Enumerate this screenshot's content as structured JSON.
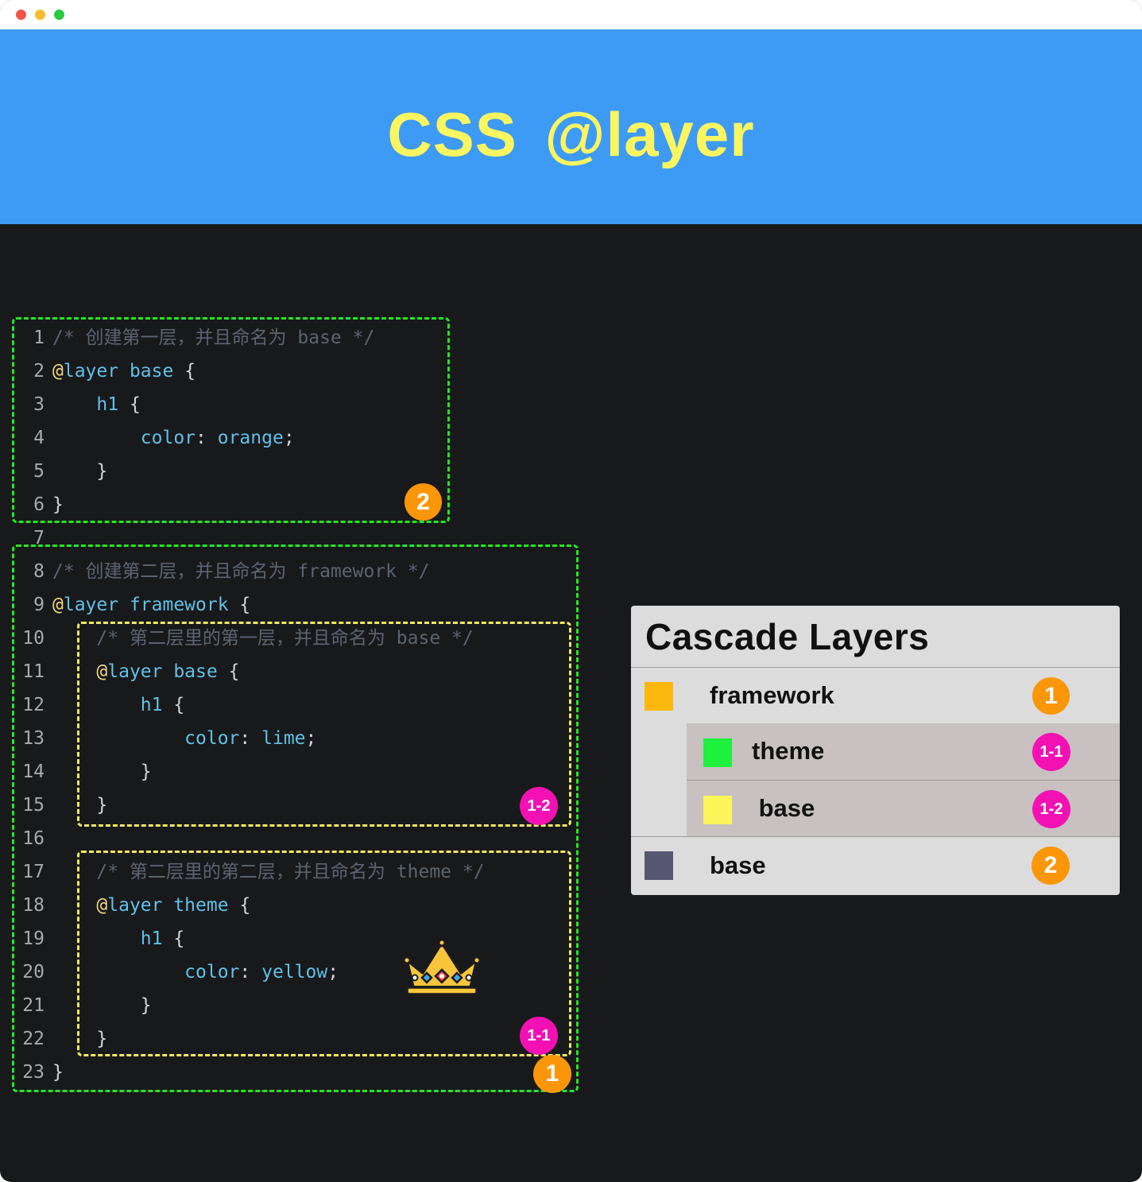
{
  "window": {
    "traffic_lights": [
      "close",
      "minimize",
      "maximize"
    ]
  },
  "banner": {
    "title": "CSS @layer"
  },
  "code": {
    "lines": [
      {
        "n": "1",
        "comment": "/* 创建第一层，并且命名为 base */"
      },
      {
        "n": "2",
        "at": "@",
        "kw": "layer base",
        "plain": " {"
      },
      {
        "n": "3",
        "indent": "    ",
        "kw": "h1",
        "plain": " {"
      },
      {
        "n": "4",
        "indent": "        ",
        "kw": "color",
        "plain": ": ",
        "kw2": "orange",
        "plain2": ";"
      },
      {
        "n": "5",
        "indent": "    ",
        "plain": "}"
      },
      {
        "n": "6",
        "plain": "}"
      },
      {
        "n": "7"
      },
      {
        "n": "8",
        "comment": "/* 创建第二层，并且命名为 framework */"
      },
      {
        "n": "9",
        "at": "@",
        "kw": "layer framework",
        "plain": " {"
      },
      {
        "n": "10",
        "indent": "    ",
        "comment": "/* 第二层里的第一层，并且命名为 base */"
      },
      {
        "n": "11",
        "indent": "    ",
        "at": "@",
        "kw": "layer base",
        "plain": " {"
      },
      {
        "n": "12",
        "indent": "        ",
        "kw": "h1",
        "plain": " {"
      },
      {
        "n": "13",
        "indent": "            ",
        "kw": "color",
        "plain": ": ",
        "kw2": "lime",
        "plain2": ";"
      },
      {
        "n": "14",
        "indent": "        ",
        "plain": "}"
      },
      {
        "n": "15",
        "indent": "    ",
        "plain": "}"
      },
      {
        "n": "16"
      },
      {
        "n": "17",
        "indent": "    ",
        "comment": "/* 第二层里的第二层，并且命名为 theme */"
      },
      {
        "n": "18",
        "indent": "    ",
        "at": "@",
        "kw": "layer theme",
        "plain": " {"
      },
      {
        "n": "19",
        "indent": "        ",
        "kw": "h1",
        "plain": " {"
      },
      {
        "n": "20",
        "indent": "            ",
        "kw": "color",
        "plain": ": ",
        "kw2": "yellow",
        "plain2": ";"
      },
      {
        "n": "21",
        "indent": "        ",
        "plain": "}"
      },
      {
        "n": "22",
        "indent": "    ",
        "plain": "}"
      },
      {
        "n": "23",
        "plain": "}"
      }
    ],
    "badges": {
      "base_outer": "2",
      "framework": "1",
      "framework_base": "1-2",
      "framework_theme": "1-1"
    },
    "crown_icon": "crown-icon"
  },
  "panel": {
    "title": "Cascade Layers",
    "rows": [
      {
        "label": "framework",
        "swatch": "#fcb80f",
        "badge": "1",
        "badge_color": "#fb9608"
      },
      {
        "label": "theme",
        "swatch": "#1ef23c",
        "badge": "1-1",
        "badge_color": "#f311b3"
      },
      {
        "label": " base",
        "swatch": "#fbf55a",
        "badge": "1-2",
        "badge_color": "#f311b3"
      },
      {
        "label": "base",
        "swatch": "#565672",
        "badge": "2",
        "badge_color": "#fb9608"
      }
    ]
  },
  "colors": {
    "banner_bg": "#3d9bf5",
    "banner_text": "#fbf560",
    "code_bg": "#18191b",
    "outer_box": "#22e81e",
    "inner_box": "#f2ea5a"
  }
}
